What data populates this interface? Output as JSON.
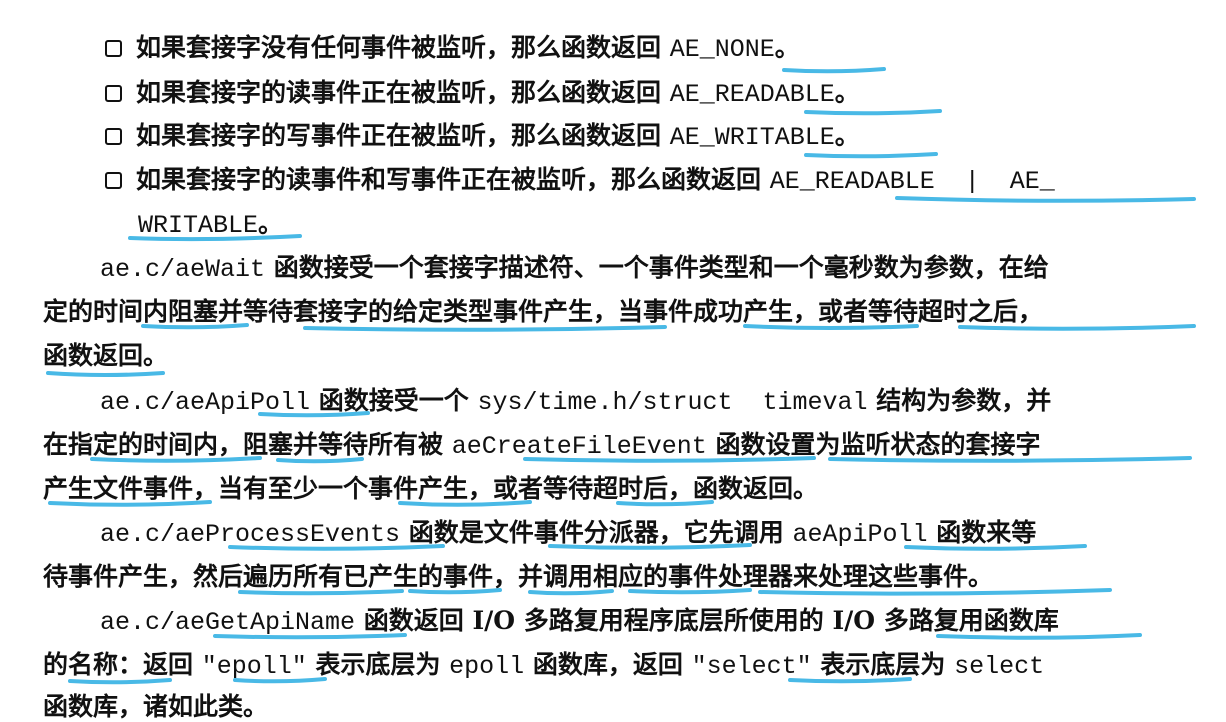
{
  "bullets": [
    {
      "text": "如果套接字没有任何事件被监听，那么函数返回 ",
      "code": "AE_NONE",
      "tail": "。"
    },
    {
      "text": "如果套接字的读事件正在被监听，那么函数返回 ",
      "code": "AE_READABLE",
      "tail": "。"
    },
    {
      "text": "如果套接字的写事件正在被监听，那么函数返回 ",
      "code": "AE_WRITABLE",
      "tail": "。"
    },
    {
      "text": "如果套接字的读事件和写事件正在被监听，那么函数返回 ",
      "code": "AE_READABLE  |  AE_",
      "cont_code": "WRITABLE",
      "tail": "。"
    }
  ],
  "paragraphs": {
    "wait": {
      "l1_code": "ae.c/aeWait",
      "l1_text": " 函数接受一个套接字描述符、一个事件类型和一个毫秒数为参数，在给",
      "l2_text": "定的时间内阻塞并等待套接字的给定类型事件产生，当事件成功产生，或者等待超时之后，",
      "l3_text": "函数返回。"
    },
    "poll": {
      "l1_code": "ae.c/aeApiPoll",
      "l1_text": " 函数接受一个 ",
      "l1_code2": "sys/time.h/struct  timeval",
      "l1_text2": " 结构为参数，并",
      "l2_text": "在指定的时间内，阻塞并等待所有被 ",
      "l2_code": "aeCreateFileEvent",
      "l2_text2": " 函数设置为监听状态的套接字",
      "l3_text": "产生文件事件，当有至少一个事件产生，或者等待超时后，函数返回。"
    },
    "process": {
      "l1_code": "ae.c/aeProcessEvents",
      "l1_text": " 函数是文件事件分派器，它先调用 ",
      "l1_code2": "aeApiPoll",
      "l1_text2": " 函数来等",
      "l2_text": "待事件产生，然后遍历所有已产生的事件，并调用相应的事件处理器来处理这些事件。"
    },
    "getname": {
      "l1_code": "ae.c/aeGetApiName",
      "l1_text": " 函数返回 I/O 多路复用程序底层所使用的 I/O 多路复用函数库",
      "l2_text": "的名称：返回 ",
      "l2_code": "\"epoll\"",
      "l2_text2": " 表示底层为 ",
      "l2_code2": "epoll",
      "l2_text3": " 函数库，返回 ",
      "l2_code3": "\"select\"",
      "l2_text4": " 表示底层为 ",
      "l2_code4": "select",
      "l3_text": "函数库，诸如此类。"
    }
  },
  "annotation_color": "#49b9e6"
}
